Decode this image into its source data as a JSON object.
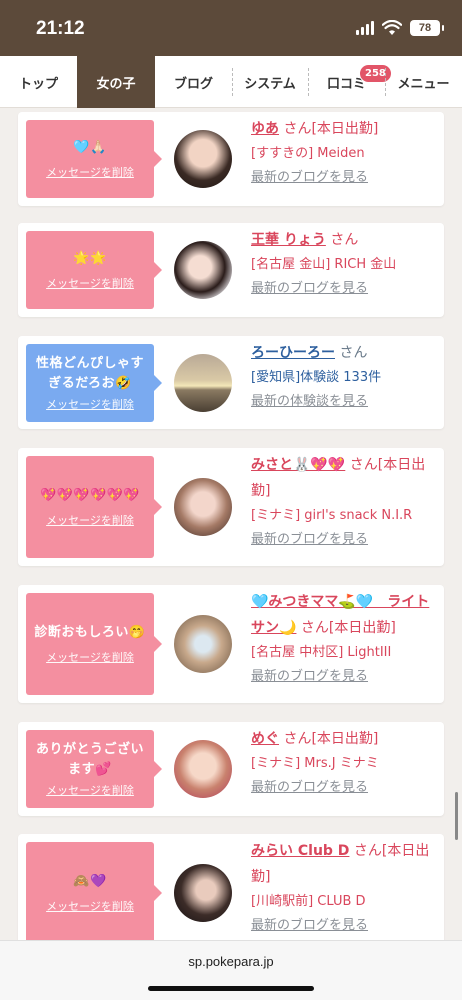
{
  "status": {
    "time": "21:12",
    "battery": "78"
  },
  "nav": {
    "tabs": [
      {
        "label": "トップ"
      },
      {
        "label": "女の子"
      },
      {
        "label": "ブログ"
      },
      {
        "label": "システム"
      },
      {
        "label": "口コミ",
        "badge": "258"
      },
      {
        "label": "メニュー"
      }
    ]
  },
  "cards": [
    {
      "message": "🩵🙏🏻",
      "delete_label": "メッセージを削除",
      "name": "ゆあ",
      "san": "さん[本日出勤]",
      "line2": "[すすきの] Meiden",
      "more": "最新のブログを見る"
    },
    {
      "message": "🌟🌟",
      "delete_label": "メッセージを削除",
      "name": "王華 りょう",
      "san": "さん",
      "line2": "[名古屋 金山] RICH 金山",
      "more": "最新のブログを見る"
    },
    {
      "message": "性格どんぴしゃすぎるだろお🤣",
      "delete_label": "メッセージを削除",
      "name": "ろーひーろー",
      "san": "さん",
      "line2": "[愛知県]体験談 133件",
      "more": "最新の体験談を見る"
    },
    {
      "message": "💖💖💖💖💖💖",
      "delete_label": "メッセージを削除",
      "name": "みさと🐰💖💖",
      "san": "さん[本日出勤]",
      "line2": "[ミナミ] girl's snack N.I.R",
      "more": "最新のブログを見る"
    },
    {
      "message": "診断おもしろい🤭",
      "delete_label": "メッセージを削除",
      "name": "🩵みつきママ⛳️🩵　ライトサン🌙",
      "san": "さん[本日出勤]",
      "line2": "[名古屋 中村区] LightIII",
      "more": "最新のブログを見る"
    },
    {
      "message": "ありがとうございます💕",
      "delete_label": "メッセージを削除",
      "name": "めぐ",
      "san": "さん[本日出勤]",
      "line2": "[ミナミ] Mrs.J ミナミ",
      "more": "最新のブログを見る"
    },
    {
      "message": "🙈💜",
      "delete_label": "メッセージを削除",
      "name": "みらい Club D",
      "san": "さん[本日出勤]",
      "line2": "[川崎駅前] CLUB D",
      "more": "最新のブログを見る"
    }
  ],
  "browser": {
    "url": "sp.pokepara.jp"
  }
}
